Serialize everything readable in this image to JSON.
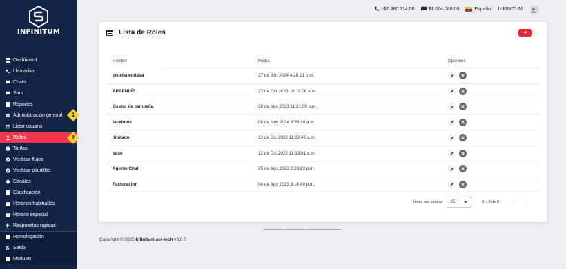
{
  "brand": {
    "name": "INFINITUM"
  },
  "sidebar": {
    "items": [
      {
        "label": "Dashboard",
        "icon": "dashboard-icon"
      },
      {
        "label": "Llamadas",
        "icon": "phone-icon"
      },
      {
        "label": "Chats",
        "icon": "chat-icon"
      },
      {
        "label": "Sms",
        "icon": "sms-icon"
      },
      {
        "label": "Reportes",
        "icon": "report-icon"
      },
      {
        "label": "Administración general",
        "icon": "gear-icon"
      },
      {
        "label": "Listar usuario",
        "icon": "users-icon"
      },
      {
        "label": "Roles",
        "icon": "roles-icon",
        "active": true
      },
      {
        "label": "Tarifas",
        "icon": "info-icon"
      },
      {
        "label": "Verificar flujos",
        "icon": "verify-icon"
      },
      {
        "label": "Verificar plantillas",
        "icon": "verify-icon"
      },
      {
        "label": "Canales",
        "icon": "channels-icon"
      },
      {
        "label": "Clasificación",
        "icon": "clipboard-icon"
      },
      {
        "label": "Horarios habituales",
        "icon": "calendar-icon"
      },
      {
        "label": "Horario especial",
        "icon": "calendar-icon"
      },
      {
        "label": "Respuestas rapidas",
        "icon": "bolt-icon"
      },
      {
        "label": "Homologación",
        "icon": "file-icon"
      },
      {
        "label": "Saldo",
        "icon": "dollar-icon"
      },
      {
        "label": "Modulos",
        "icon": "modules-icon"
      }
    ],
    "badges": [
      "1",
      "2"
    ]
  },
  "topbar": {
    "balance_phone": "-$7.480.714,00",
    "balance_message": "$1.664.080,00",
    "language": "Español",
    "user": "INFINITUM"
  },
  "card": {
    "title": "Lista de Roles",
    "add_label": "+",
    "columns": [
      "Nombre",
      "Fecha",
      "Opciones"
    ],
    "rows": [
      {
        "name": "prueba editada",
        "date": "17 de Jun 2024 4:28:21 p.m."
      },
      {
        "name": "APRENDÍZ",
        "date": "23 de Oct 2023 10:19:08 a.m."
      },
      {
        "name": "Gestor de campaña",
        "date": "28 de Ago 2023 11:21:09 p.m."
      },
      {
        "name": "facebook",
        "date": "08 de Nov 2024 9:59:10 a.m."
      },
      {
        "name": "limitado",
        "date": "13 de Dic 2022 11:32:42 a.m."
      },
      {
        "name": "base",
        "date": "12 de Dic 2022 11:33:01 a.m."
      },
      {
        "name": "Agente Chat",
        "date": "25 de Ago 2023 2:26:23 p.m."
      },
      {
        "name": "Facturacion",
        "date": "04 de Ago 2023 3:14:49 p.m."
      }
    ],
    "paginator": {
      "items_per_page_label": "Items por página:",
      "page_size": "25",
      "range": "1 – 8 de 8"
    }
  },
  "footer": {
    "prefix": "Copyright © 2025 ",
    "company": "Infinitum sci-tech",
    "version": " v3.0.0"
  },
  "colors": {
    "sidebar": "#142447",
    "active": "#f0384c",
    "accent": "#e8283a",
    "badge": "#f5d033"
  }
}
